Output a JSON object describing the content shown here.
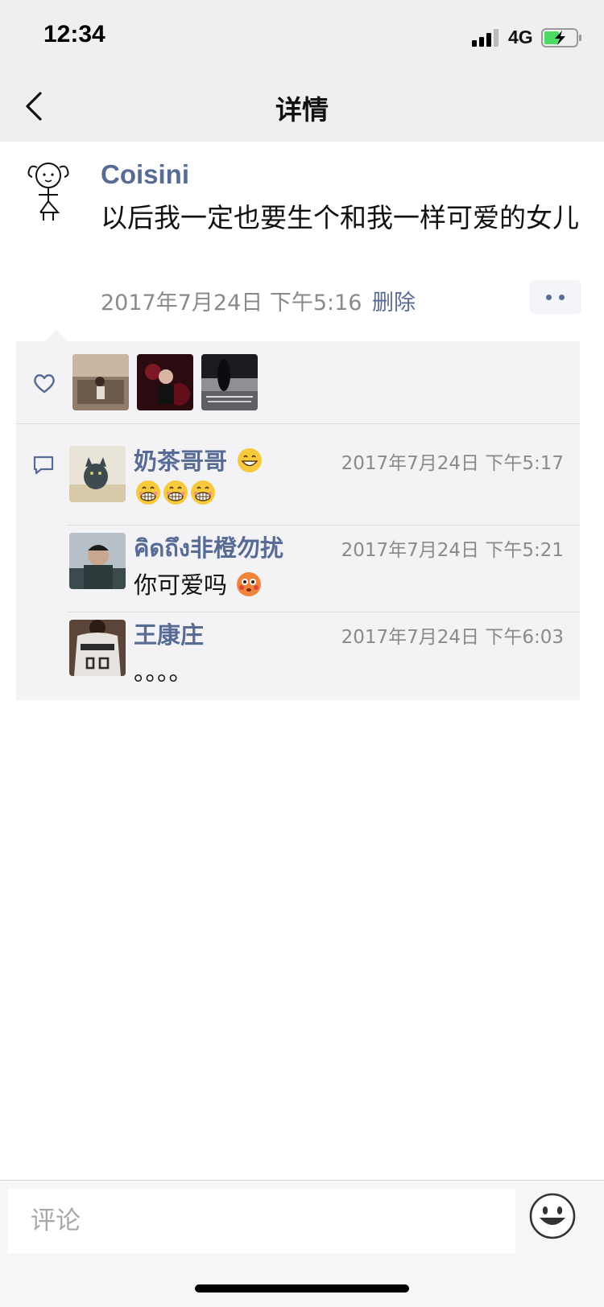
{
  "status_bar": {
    "time": "12:34",
    "network": "4G",
    "battery_icon": "battery-charging-icon",
    "signal_icon": "signal-icon"
  },
  "nav": {
    "title": "详情",
    "back_icon": "chevron-left-icon"
  },
  "post": {
    "author": "Coisini",
    "text": "以后我一定也要生个和我一样可爱的女儿",
    "time": "2017年7月24日 下午5:16",
    "delete_label": "删除",
    "more_icon": "more-dots-icon"
  },
  "likes": {
    "icon": "heart-icon",
    "avatars": [
      "like-avatar-1",
      "like-avatar-2",
      "like-avatar-3"
    ]
  },
  "comments": [
    {
      "name": "奶茶哥哥",
      "time": "2017年7月24日 下午5:17",
      "text": ""
    },
    {
      "name": "คิดถึง非橙勿扰",
      "time": "2017年7月24日 下午5:21",
      "text": "你可爱吗"
    },
    {
      "name": "王康庄",
      "time": "2017年7月24日 下午6:03",
      "text": "。。。。"
    }
  ],
  "comment_bar": {
    "placeholder": "评论",
    "emoji_icon": "smiley-icon"
  },
  "colors": {
    "link": "#576b95",
    "panel_bg": "#f3f3f5",
    "header_bg": "#efefef"
  }
}
